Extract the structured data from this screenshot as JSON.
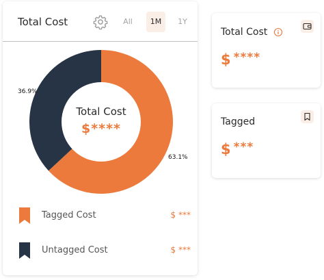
{
  "colors": {
    "accent": "#ec7a3c",
    "dark": "#263445",
    "accent_soft": "#fbeee6"
  },
  "main": {
    "title": "Total Cost",
    "periods": [
      {
        "label": "All",
        "active": false
      },
      {
        "label": "1M",
        "active": true
      },
      {
        "label": "1Y",
        "active": false
      }
    ],
    "donut": {
      "center_label": "Total Cost",
      "center_value": "$****",
      "slices": [
        {
          "name": "Tagged Cost",
          "percent": 63.1,
          "percent_label": "63.1%",
          "color": "#ec7a3c"
        },
        {
          "name": "Untagged Cost",
          "percent": 36.9,
          "percent_label": "36.9%",
          "color": "#263445"
        }
      ]
    },
    "legend": [
      {
        "label": "Tagged Cost",
        "value": "$ ***",
        "icon": "bookmark-orange-icon"
      },
      {
        "label": "Untagged Cost",
        "value": "$ ***",
        "icon": "bookmark-dark-icon"
      }
    ]
  },
  "total_card": {
    "title": "Total Cost",
    "currency": "$",
    "value": "****",
    "icon": "wallet-icon",
    "info_icon": "info-icon"
  },
  "tagged_card": {
    "title": "Tagged",
    "currency": "$",
    "value": "***",
    "icon": "bookmark-icon"
  }
}
